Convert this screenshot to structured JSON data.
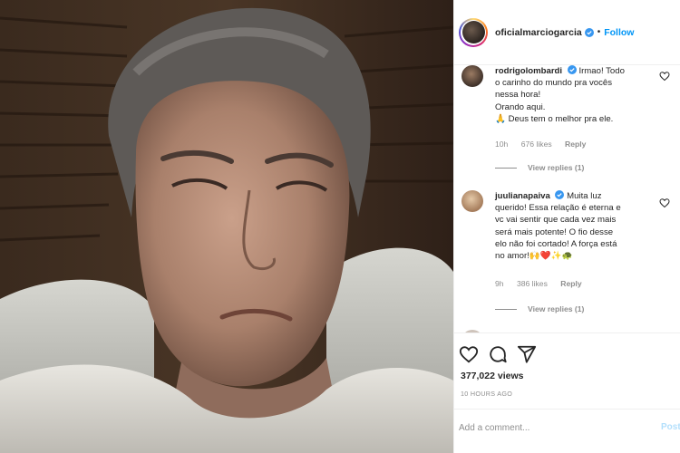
{
  "post": {
    "username": "oficialmarciogarcia",
    "separator": "•",
    "follow_label": "Follow",
    "views": "377,022 views",
    "time_ago": "10 HOURS AGO"
  },
  "comments": [
    {
      "username": "rodrigolombardi",
      "text_lines": [
        "Irmao! Todo",
        "o carinho do mundo pra vocês",
        "nessa hora!",
        "Orando aqui.",
        "🙏 Deus tem o melhor pra ele."
      ],
      "time": "10h",
      "likes": "676 likes",
      "reply_label": "Reply",
      "view_replies": "View replies (1)"
    },
    {
      "username": "juulianapaiva",
      "text_lines": [
        "Muita luz",
        "querido! Essa relação é eterna e",
        "vc vai sentir que cada vez mais",
        "será mais potente! O fio desse",
        "elo não foi cortado! A força está",
        "no amor!🙌❤️✨🐢"
      ],
      "time": "9h",
      "likes": "386 likes",
      "reply_label": "Reply",
      "view_replies": "View replies (1)"
    }
  ],
  "add_comment": {
    "placeholder": "Add a comment...",
    "post_label": "Post"
  },
  "colors": {
    "link_blue": "#0095f6",
    "post_disabled": "#b2dffc",
    "muted": "#8e8e8e",
    "text": "#262626"
  },
  "icons": [
    "verified-badge-icon",
    "heart-icon",
    "comment-icon",
    "share-icon"
  ]
}
